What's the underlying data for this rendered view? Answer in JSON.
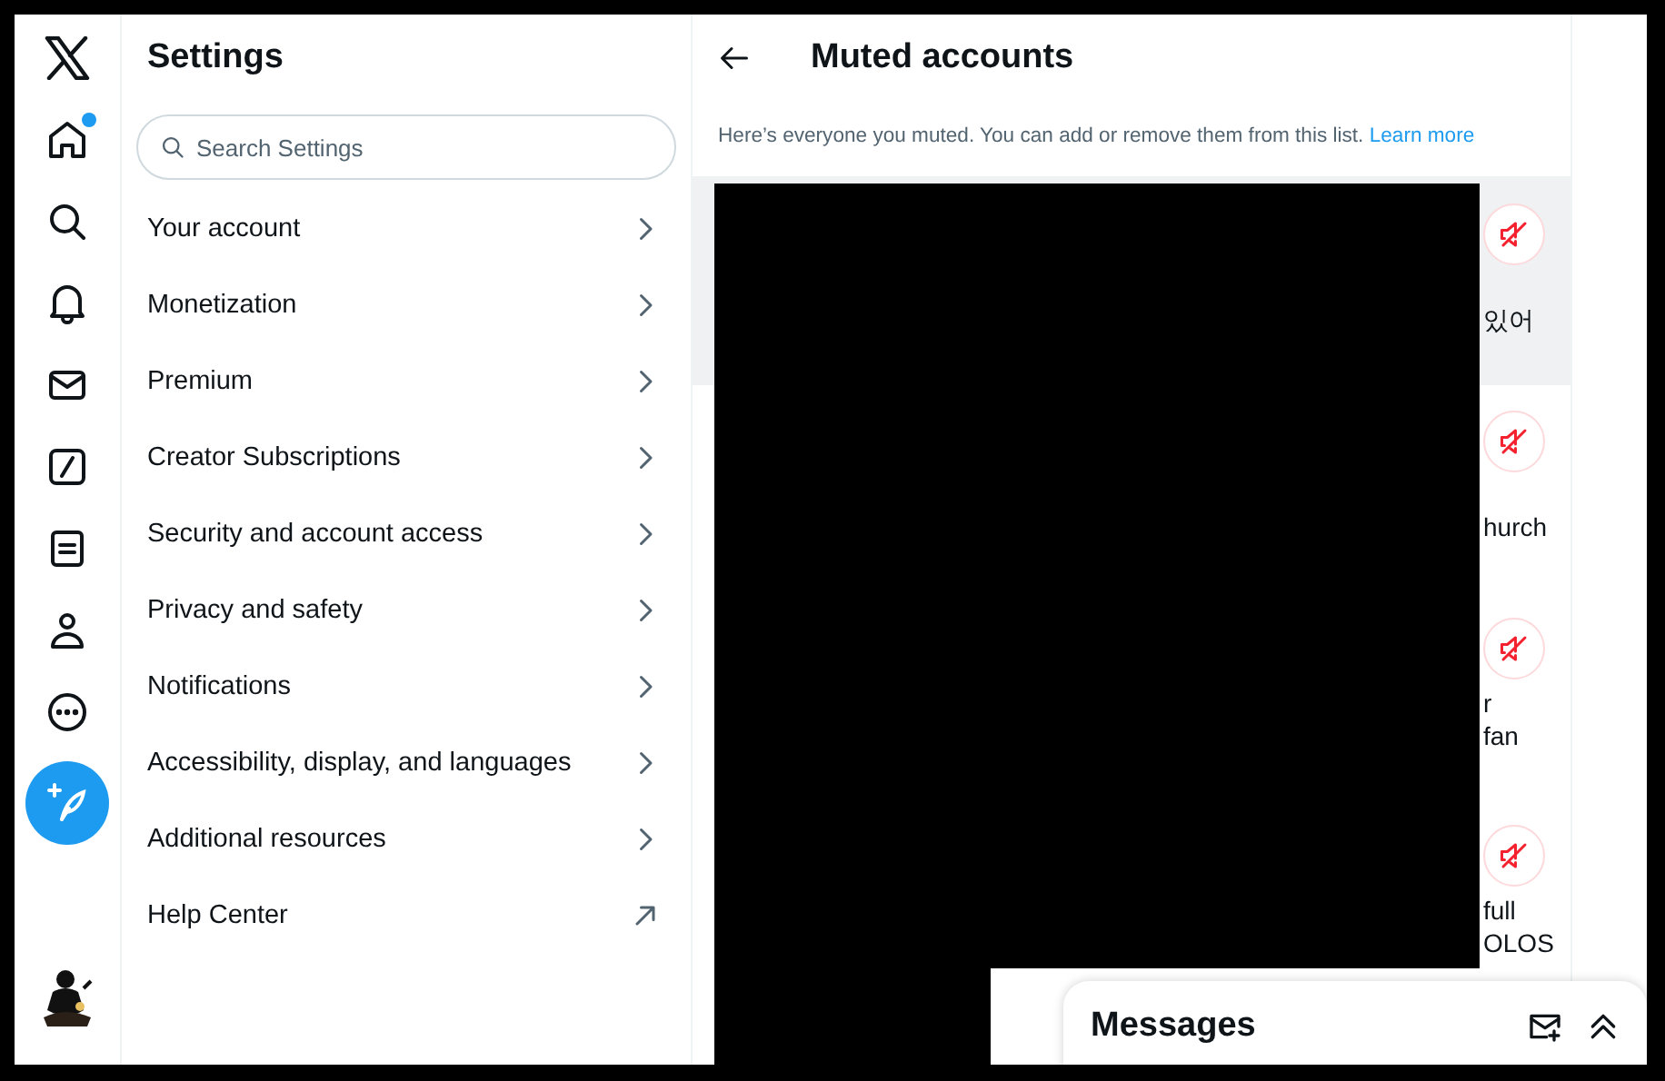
{
  "nav": {
    "items": [
      {
        "kind": "logo",
        "dot": false
      },
      {
        "kind": "home",
        "dot": true
      },
      {
        "kind": "search",
        "dot": false
      },
      {
        "kind": "notifications",
        "dot": false
      },
      {
        "kind": "messages",
        "dot": false
      },
      {
        "kind": "grok",
        "dot": false
      },
      {
        "kind": "lists",
        "dot": false
      },
      {
        "kind": "profile",
        "dot": false
      },
      {
        "kind": "more",
        "dot": false
      },
      {
        "kind": "compose",
        "dot": false
      }
    ]
  },
  "settings": {
    "title": "Settings",
    "search": {
      "placeholder": "Search Settings"
    },
    "items": [
      {
        "label": "Your account",
        "kind": "chevron"
      },
      {
        "label": "Monetization",
        "kind": "chevron"
      },
      {
        "label": "Premium",
        "kind": "chevron"
      },
      {
        "label": "Creator Subscriptions",
        "kind": "chevron"
      },
      {
        "label": "Security and account access",
        "kind": "chevron"
      },
      {
        "label": "Privacy and safety",
        "kind": "chevron"
      },
      {
        "label": "Notifications",
        "kind": "chevron"
      },
      {
        "label": "Accessibility, display, and languages",
        "kind": "chevron"
      },
      {
        "label": "Additional resources",
        "kind": "chevron"
      },
      {
        "label": "Help Center",
        "kind": "external"
      }
    ]
  },
  "muted": {
    "title": "Muted accounts",
    "description": "Here’s everyone you muted. You can add or remove them from this list.",
    "link": "Learn more",
    "rows": [
      {
        "lines": [
          "있어"
        ],
        "highlighted": true
      },
      {
        "lines": [
          "hurch"
        ],
        "highlighted": false
      },
      {
        "lines": [
          "r",
          "fan"
        ],
        "highlighted": false
      },
      {
        "lines": [
          "full",
          "OLOS"
        ],
        "highlighted": false
      }
    ]
  },
  "messages": {
    "title": "Messages"
  }
}
